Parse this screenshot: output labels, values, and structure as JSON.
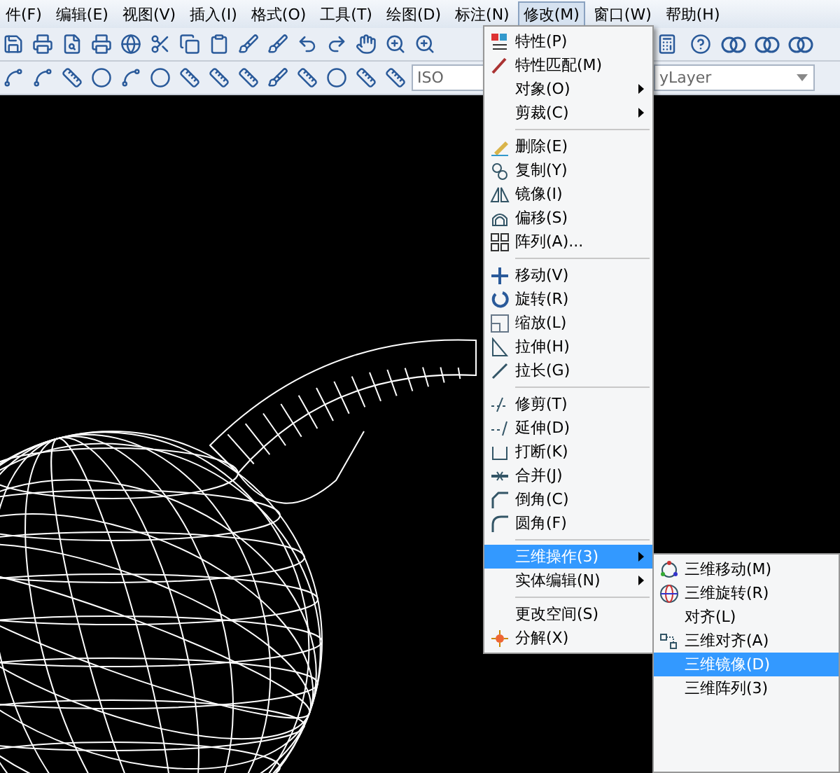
{
  "menu_bar": [
    {
      "label": "件(F)",
      "selected": false
    },
    {
      "label": "编辑(E)",
      "selected": false
    },
    {
      "label": "视图(V)",
      "selected": false
    },
    {
      "label": "插入(I)",
      "selected": false
    },
    {
      "label": "格式(O)",
      "selected": false
    },
    {
      "label": "工具(T)",
      "selected": false
    },
    {
      "label": "绘图(D)",
      "selected": false
    },
    {
      "label": "标注(N)",
      "selected": false
    },
    {
      "label": "修改(M)",
      "selected": true
    },
    {
      "label": "窗口(W)",
      "selected": false
    },
    {
      "label": "帮助(H)",
      "selected": false
    }
  ],
  "toolbar": {
    "style_field": "ISO",
    "layer_field": "yLayer"
  },
  "modify_menu": [
    {
      "kind": "item",
      "label": "特性(P)",
      "submenu": false,
      "selected": false
    },
    {
      "kind": "item",
      "label": "特性匹配(M)",
      "submenu": false,
      "selected": false
    },
    {
      "kind": "item",
      "label": "对象(O)",
      "submenu": true,
      "selected": false
    },
    {
      "kind": "item",
      "label": "剪裁(C)",
      "submenu": true,
      "selected": false
    },
    {
      "kind": "separator"
    },
    {
      "kind": "item",
      "label": "删除(E)",
      "submenu": false,
      "selected": false
    },
    {
      "kind": "item",
      "label": "复制(Y)",
      "submenu": false,
      "selected": false
    },
    {
      "kind": "item",
      "label": "镜像(I)",
      "submenu": false,
      "selected": false
    },
    {
      "kind": "item",
      "label": "偏移(S)",
      "submenu": false,
      "selected": false
    },
    {
      "kind": "item",
      "label": "阵列(A)...",
      "submenu": false,
      "selected": false
    },
    {
      "kind": "separator"
    },
    {
      "kind": "item",
      "label": "移动(V)",
      "submenu": false,
      "selected": false
    },
    {
      "kind": "item",
      "label": "旋转(R)",
      "submenu": false,
      "selected": false
    },
    {
      "kind": "item",
      "label": "缩放(L)",
      "submenu": false,
      "selected": false
    },
    {
      "kind": "item",
      "label": "拉伸(H)",
      "submenu": false,
      "selected": false
    },
    {
      "kind": "item",
      "label": "拉长(G)",
      "submenu": false,
      "selected": false
    },
    {
      "kind": "separator"
    },
    {
      "kind": "item",
      "label": "修剪(T)",
      "submenu": false,
      "selected": false
    },
    {
      "kind": "item",
      "label": "延伸(D)",
      "submenu": false,
      "selected": false
    },
    {
      "kind": "item",
      "label": "打断(K)",
      "submenu": false,
      "selected": false
    },
    {
      "kind": "item",
      "label": "合并(J)",
      "submenu": false,
      "selected": false
    },
    {
      "kind": "item",
      "label": "倒角(C)",
      "submenu": false,
      "selected": false
    },
    {
      "kind": "item",
      "label": "圆角(F)",
      "submenu": false,
      "selected": false
    },
    {
      "kind": "separator"
    },
    {
      "kind": "item",
      "label": "三维操作(3)",
      "submenu": true,
      "selected": true
    },
    {
      "kind": "item",
      "label": "实体编辑(N)",
      "submenu": true,
      "selected": false
    },
    {
      "kind": "separator"
    },
    {
      "kind": "item",
      "label": "更改空间(S)",
      "submenu": false,
      "selected": false
    },
    {
      "kind": "item",
      "label": "分解(X)",
      "submenu": false,
      "selected": false
    }
  ],
  "submenu_3d": [
    {
      "label": "三维移动(M)",
      "selected": false
    },
    {
      "label": "三维旋转(R)",
      "selected": false
    },
    {
      "label": "对齐(L)",
      "selected": false
    },
    {
      "label": "三维对齐(A)",
      "selected": false
    },
    {
      "label": "三维镜像(D)",
      "selected": true
    },
    {
      "label": "三维阵列(3)",
      "selected": false
    }
  ]
}
